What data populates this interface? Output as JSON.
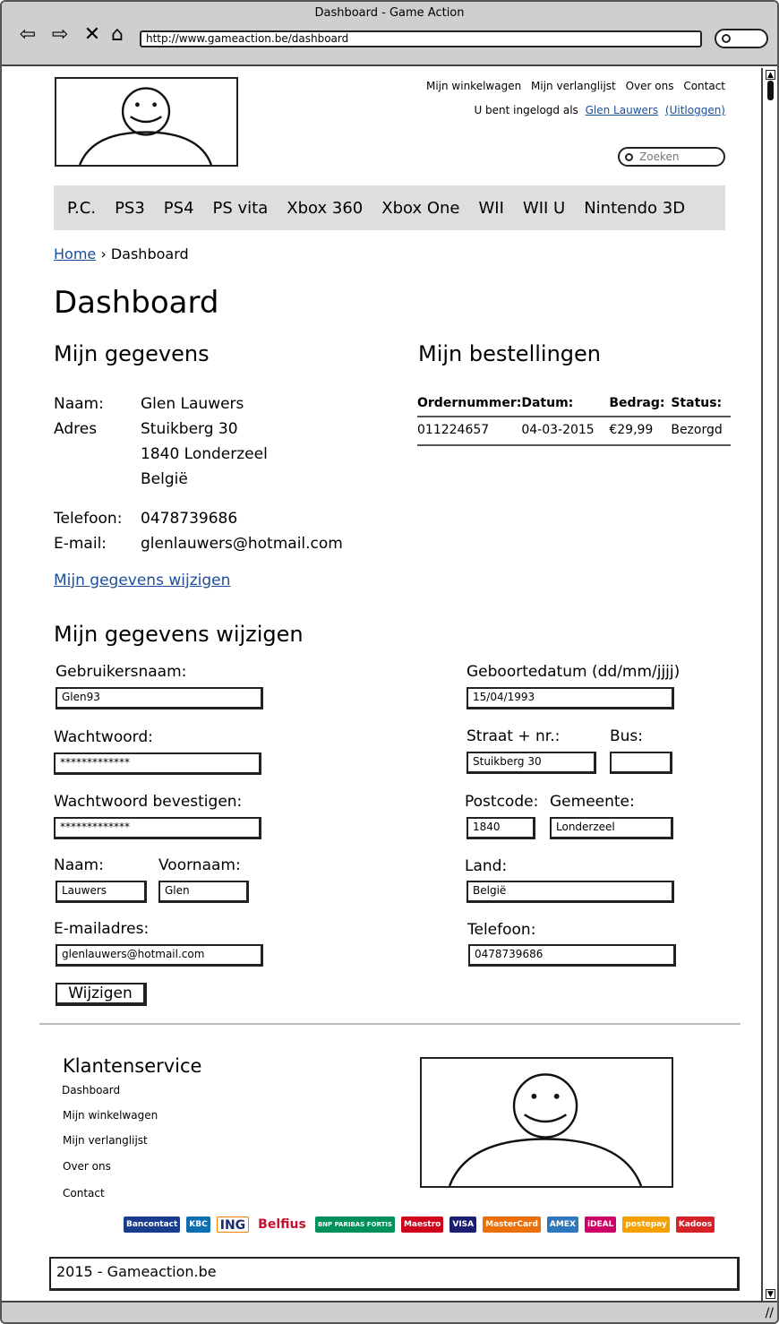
{
  "window": {
    "title": "Dashboard - Game Action",
    "url": "http://www.gameaction.be/dashboard"
  },
  "header": {
    "links": [
      "Mijn winkelwagen",
      "Mijn verlanglijst",
      "Over ons",
      "Contact"
    ],
    "login_prefix": "U bent ingelogd als",
    "user_link": "Glen Lauwers",
    "logout_link": "(Uitloggen)",
    "search_placeholder": "Zoeken"
  },
  "categories": [
    "P.C.",
    "PS3",
    "PS4",
    "PS vita",
    "Xbox 360",
    "Xbox One",
    "WII",
    "WII U",
    "Nintendo 3D"
  ],
  "breadcrumb": {
    "home": "Home",
    "separator": "›",
    "current": "Dashboard"
  },
  "page_title": "Dashboard",
  "mijn_gegevens": {
    "heading": "Mijn gegevens",
    "naam_label": "Naam:",
    "naam": "Glen Lauwers",
    "adres_label": "Adres",
    "adres_lines": [
      "Stuikberg 30",
      "1840 Londerzeel",
      "België"
    ],
    "telefoon_label": "Telefoon:",
    "telefoon": "0478739686",
    "email_label": "E-mail:",
    "email": "glenlauwers@hotmail.com",
    "edit_link": "Mijn gegevens wijzigen"
  },
  "bestellingen": {
    "heading": "Mijn bestellingen",
    "columns": [
      "Ordernummer:",
      "Datum:",
      "Bedrag:",
      "Status:"
    ],
    "rows": [
      [
        "011224657",
        "04-03-2015",
        "€29,99",
        "Bezorgd"
      ]
    ]
  },
  "form": {
    "heading": "Mijn gegevens wijzigen",
    "gebruikersnaam_label": "Gebruikersnaam:",
    "gebruikersnaam": "Glen93",
    "wachtwoord_label": "Wachtwoord:",
    "wachtwoord": "*************",
    "bevestigen_label": "Wachtwoord bevestigen:",
    "bevestigen": "*************",
    "naam_label": "Naam:",
    "naam": "Lauwers",
    "voornaam_label": "Voornaam:",
    "voornaam": "Glen",
    "email_label": "E-mailadres:",
    "email": "glenlauwers@hotmail.com",
    "geboortedatum_label": "Geboortedatum (dd/mm/jjjj)",
    "geboortedatum": "15/04/1993",
    "straat_label": "Straat + nr.:",
    "straat": "Stuikberg 30",
    "bus_label": "Bus:",
    "bus": "",
    "postcode_label": "Postcode:",
    "postcode": "1840",
    "gemeente_label": "Gemeente:",
    "gemeente": "Londerzeel",
    "land_label": "Land:",
    "land": "België",
    "telefoon_label": "Telefoon:",
    "telefoon": "0478739686",
    "submit": "Wijzigen"
  },
  "klantenservice": {
    "title": "Klantenservice",
    "items": [
      "Dashboard",
      "Mijn winkelwagen",
      "Mijn verlanglijst",
      "Over ons",
      "Contact"
    ]
  },
  "payments": [
    "Bancontact",
    "KBC",
    "ING",
    "Belfius",
    "BNP PARIBAS FORTIS",
    "Maestro",
    "VISA",
    "MasterCard",
    "AMEX",
    "iDEAL",
    "postepay",
    "Kadoos"
  ],
  "footer": {
    "copyright": "2015 - Gameaction.be"
  }
}
